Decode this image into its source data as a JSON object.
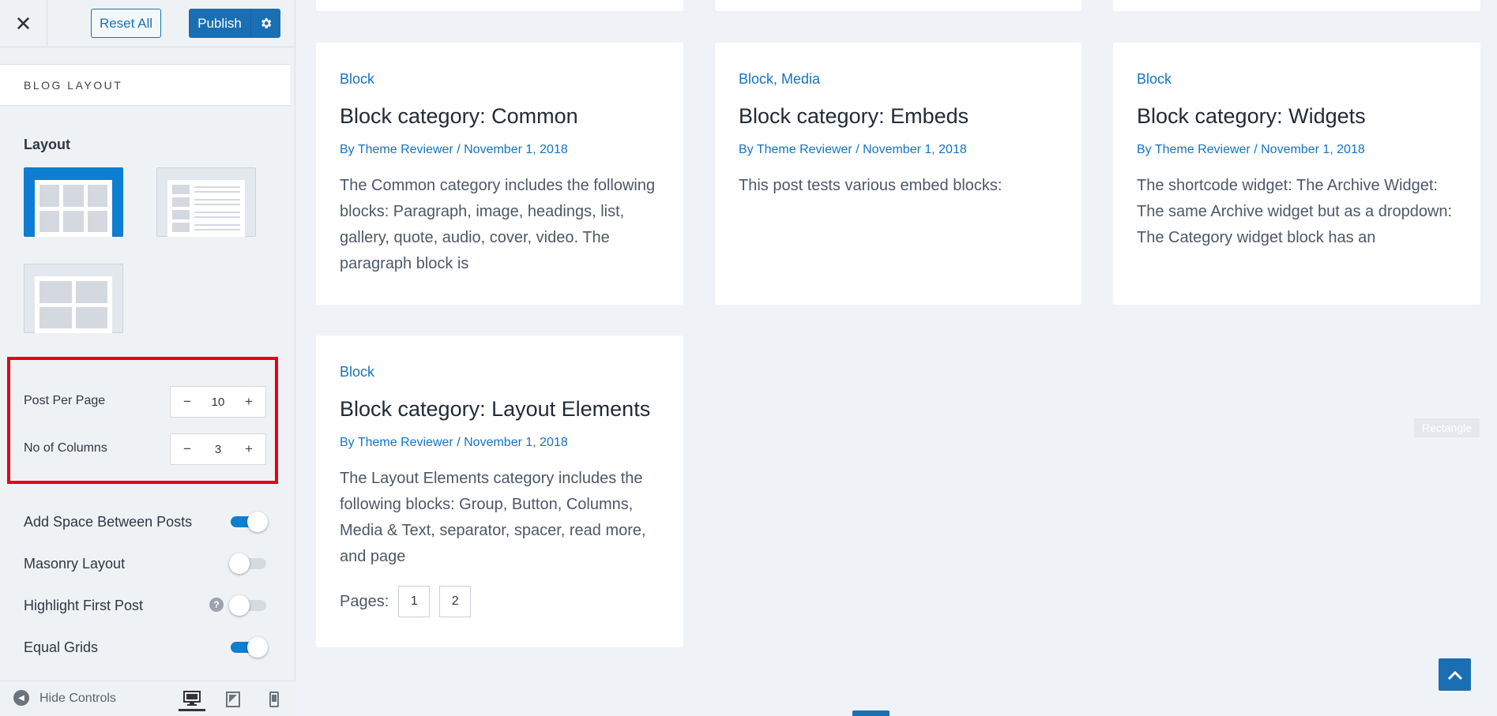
{
  "sidebar": {
    "reset_label": "Reset All",
    "publish_label": "Publish",
    "section_title": "BLOG LAYOUT",
    "layout_label": "Layout",
    "post_per_page": {
      "label": "Post Per Page",
      "value": "10",
      "minus": "−",
      "plus": "+"
    },
    "no_of_columns": {
      "label": "No of Columns",
      "value": "3",
      "minus": "−",
      "plus": "+"
    },
    "toggles": [
      {
        "label": "Add Space Between Posts",
        "on": true
      },
      {
        "label": "Masonry Layout",
        "on": false
      },
      {
        "label": "Highlight First Post",
        "on": false
      },
      {
        "label": "Equal Grids",
        "on": true
      }
    ],
    "help_glyph": "?",
    "hide_controls": "Hide Controls"
  },
  "posts": [
    {
      "categories": [
        "Block"
      ],
      "title": "Block category: Common",
      "author": "By Theme Reviewer",
      "date": "November 1, 2018",
      "excerpt": "The Common category includes the following blocks: Paragraph, image, headings, list, gallery, quote, audio, cover, video. The paragraph block is"
    },
    {
      "categories": [
        "Block",
        "Media"
      ],
      "title": "Block category: Embeds",
      "author": "By Theme Reviewer",
      "date": "November 1, 2018",
      "excerpt": "This post tests various embed blocks:"
    },
    {
      "categories": [
        "Block"
      ],
      "title": "Block category: Widgets",
      "author": "By Theme Reviewer",
      "date": "November 1, 2018",
      "excerpt": "The shortcode widget: The Archive Widget: The same Archive widget but as a dropdown: The Category widget block has an"
    },
    {
      "categories": [
        "Block"
      ],
      "title": "Block category: Layout Elements",
      "author": "By Theme Reviewer",
      "date": "November 1, 2018",
      "excerpt": "The Layout Elements category includes the following blocks: Group, Button, Columns, Media & Text, separator, spacer, read more, and page"
    }
  ],
  "pagination": {
    "label": "Pages:",
    "pages": [
      "1",
      "2"
    ]
  },
  "rectangle_label": "Rectangle",
  "colors": {
    "accent": "#1a6fb2",
    "link": "#1474c4",
    "highlight": "#e3001b"
  }
}
